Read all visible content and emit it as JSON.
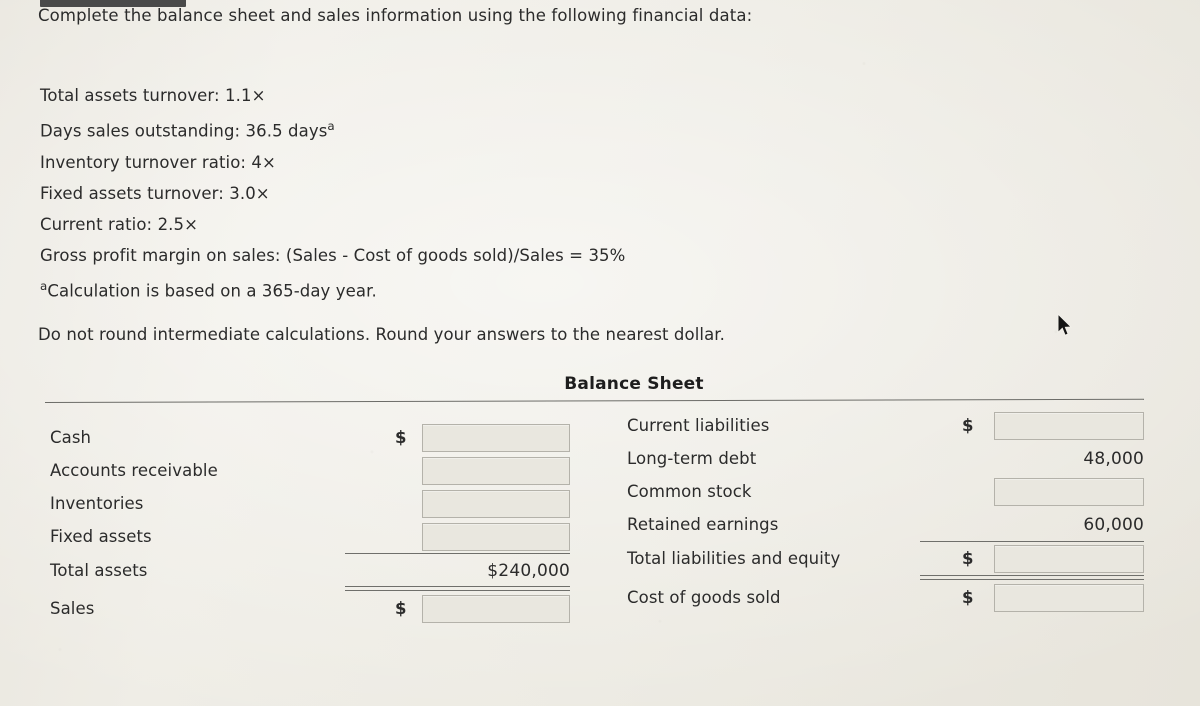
{
  "document": {
    "intro": "Complete the balance sheet and sales information using the following financial data:",
    "facts": [
      "Total assets turnover: 1.1×",
      "Days sales outstanding: 36.5 days",
      "Inventory turnover ratio: 4×",
      "Fixed assets turnover: 3.0×",
      "Current ratio: 2.5×",
      "Gross profit margin on sales: (Sales - Cost of goods sold)/Sales = 35%"
    ],
    "footnote_marker": "a",
    "footnote": "Calculation is based on a 365-day year.",
    "rounding_note": "Do not round intermediate calculations. Round your answers to the nearest dollar."
  },
  "balance_sheet": {
    "title": "Balance Sheet",
    "currency_symbol": "$",
    "left_rows": [
      {
        "label": "Cash",
        "dollar": "$",
        "type": "input",
        "value": ""
      },
      {
        "label": "Accounts receivable",
        "dollar": "",
        "type": "input",
        "value": ""
      },
      {
        "label": "Inventories",
        "dollar": "",
        "type": "input",
        "value": ""
      },
      {
        "label": "Fixed assets",
        "dollar": "",
        "type": "input",
        "value": ""
      },
      {
        "label": "Total assets",
        "dollar": "",
        "type": "amount",
        "value": "$240,000"
      },
      {
        "label": "Sales",
        "dollar": "$",
        "type": "input",
        "value": ""
      }
    ],
    "right_rows": [
      {
        "label": "Current liabilities",
        "dollar": "$",
        "type": "input",
        "value": ""
      },
      {
        "label": "Long-term debt",
        "dollar": "",
        "type": "amount",
        "value": "48,000"
      },
      {
        "label": "Common stock",
        "dollar": "",
        "type": "input",
        "value": ""
      },
      {
        "label": "Retained earnings",
        "dollar": "",
        "type": "amount",
        "value": "60,000"
      },
      {
        "label": "Total liabilities and equity",
        "dollar": "$",
        "type": "input",
        "value": ""
      },
      {
        "label": "Cost of goods sold",
        "dollar": "$",
        "type": "input",
        "value": ""
      }
    ]
  },
  "pointer": {
    "icon": "mouse-cursor-arrow"
  },
  "colors": {
    "page_background": "#edeae2",
    "text": "#2b2b2b",
    "rule": "#6f6f6b",
    "input_border": "#b4b2aa",
    "input_fill": "#e9e7df",
    "top_strip": "#4a4a4a"
  }
}
